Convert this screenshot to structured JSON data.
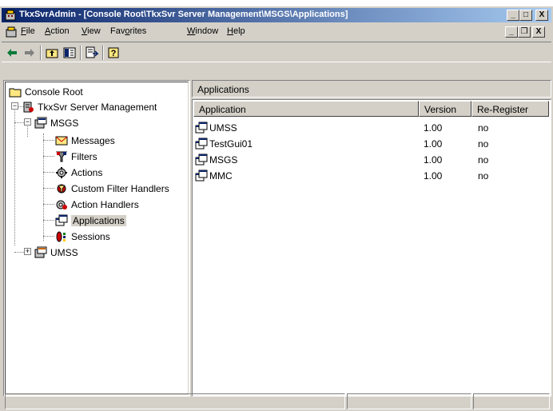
{
  "window": {
    "title": "TkxSvrAdmin - [Console Root\\TkxSvr Server Management\\MSGS\\Applications]",
    "controls": {
      "minimize": "_",
      "maximize": "□",
      "close": "X"
    }
  },
  "menu": {
    "items": [
      {
        "label": "File",
        "accel": "F",
        "rest": "ile"
      },
      {
        "label": "Action",
        "accel": "A",
        "rest": "ction"
      },
      {
        "label": "View",
        "accel": "V",
        "rest": "iew"
      },
      {
        "label": "Favorites",
        "pre": "Fav",
        "accel": "o",
        "rest": "rites"
      },
      {
        "label": "Window",
        "accel": "W",
        "rest": "indow"
      },
      {
        "label": "Help",
        "accel": "H",
        "rest": "elp"
      }
    ],
    "mdi_controls": {
      "minimize": "_",
      "restore": "❐",
      "close": "X"
    }
  },
  "toolbar": {
    "icons": [
      "back-arrow-icon",
      "forward-arrow-icon",
      "up-folder-icon",
      "show-hide-tree-icon",
      "export-list-icon",
      "help-icon"
    ]
  },
  "tree": {
    "root": "Console Root",
    "server": "TkxSvr Server Management",
    "msgs": "MSGS",
    "children": [
      "Messages",
      "Filters",
      "Actions",
      "Custom Filter Handlers",
      "Action Handlers",
      "Applications",
      "Sessions"
    ],
    "selected": "Applications",
    "umss": "UMSS"
  },
  "right_pane": {
    "header": "Applications",
    "columns": [
      "Application",
      "Version",
      "Re-Register"
    ],
    "rows": [
      {
        "application": "UMSS",
        "version": "1.00",
        "reregister": "no"
      },
      {
        "application": "TestGui01",
        "version": "1.00",
        "reregister": "no"
      },
      {
        "application": "MSGS",
        "version": "1.00",
        "reregister": "no"
      },
      {
        "application": "MMC",
        "version": "1.00",
        "reregister": "no"
      }
    ]
  },
  "colors": {
    "titlebar_start": "#0a246a",
    "titlebar_end": "#a6caf0",
    "chrome": "#d4d0c8"
  }
}
